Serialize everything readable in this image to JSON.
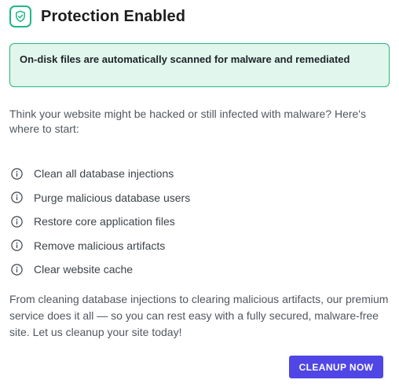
{
  "header": {
    "title": "Protection Enabled",
    "icon": "shield-check-icon",
    "accent_color": "#1fb884"
  },
  "notice": {
    "text": "On-disk files are automatically scanned for malware and remediated",
    "background": "#e1f6ed",
    "border_color": "#27b77e"
  },
  "intro": "Think your website might be hacked or still infected with malware? Here's where to start:",
  "steps": [
    {
      "label": "Clean all database injections",
      "icon": "info-icon"
    },
    {
      "label": "Purge malicious database users",
      "icon": "info-icon"
    },
    {
      "label": "Restore core application files",
      "icon": "info-icon"
    },
    {
      "label": "Remove malicious artifacts",
      "icon": "info-icon"
    },
    {
      "label": "Clear website cache",
      "icon": "info-icon"
    }
  ],
  "outro": "From cleaning database injections to clearing malicious artifacts, our premium service does it all — so you can rest easy with a fully secured, malware-free site. Let us cleanup your site today!",
  "cta": {
    "label": "CLEANUP NOW",
    "color": "#4f46e5"
  }
}
